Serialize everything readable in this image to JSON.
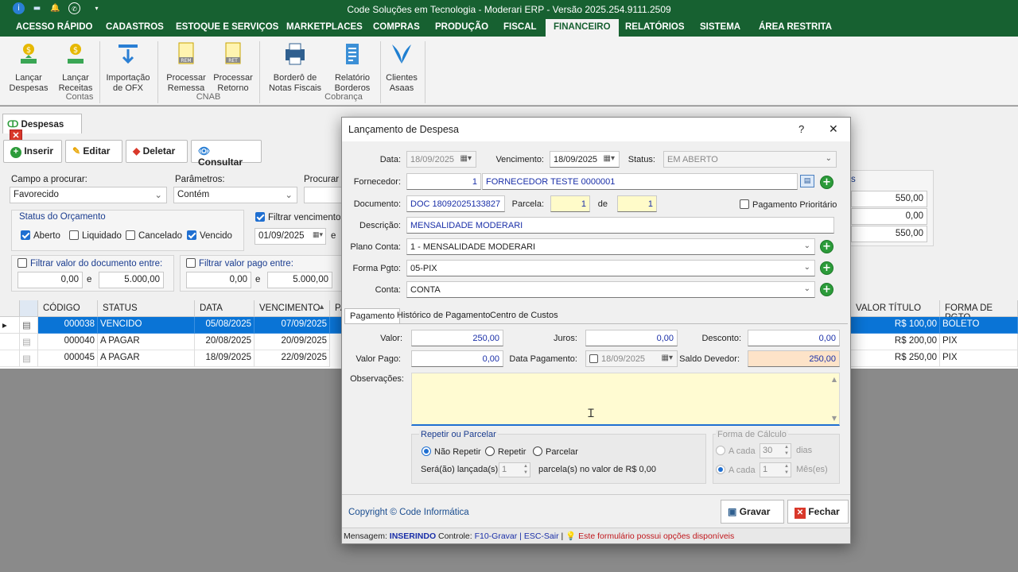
{
  "titlebar": {
    "title": "Code Soluções em Tecnologia - Moderari ERP - Versão 2025.254.9111.2509"
  },
  "menu": [
    "ACESSO RÁPIDO",
    "CADASTROS",
    "ESTOQUE E SERVIÇOS",
    "MARKETPLACES",
    "COMPRAS",
    "PRODUÇÃO",
    "FISCAL",
    "FINANCEIRO",
    "RELATÓRIOS",
    "SISTEMA",
    "ÁREA RESTRITA"
  ],
  "ribbon": {
    "buttons": [
      {
        "l1": "Lançar",
        "l2": "Despesas",
        "icon": "money-out-icon"
      },
      {
        "l1": "Lançar",
        "l2": "Receitas",
        "icon": "money-in-icon"
      },
      {
        "l1": "Importação",
        "l2": "de OFX",
        "icon": "import-icon"
      },
      {
        "l1": "Processar",
        "l2": "Remessa",
        "icon": "rem-file-icon"
      },
      {
        "l1": "Processar",
        "l2": "Retorno",
        "icon": "ret-file-icon"
      },
      {
        "l1": "Borderô de",
        "l2": "Notas Fiscais",
        "icon": "printer-icon"
      },
      {
        "l1": "Relatório",
        "l2": "Borderos",
        "icon": "report-icon"
      },
      {
        "l1": "Clientes",
        "l2": "Asaas",
        "icon": "asaas-icon"
      }
    ],
    "groups": [
      "Contas",
      "CNAB",
      "Cobrança"
    ]
  },
  "tab": {
    "label": "Despesas"
  },
  "toolbar": {
    "insert": "Inserir",
    "edit": "Editar",
    "delete": "Deletar",
    "query": "Consultar"
  },
  "filters": {
    "field_label": "Campo a procurar:",
    "field_value": "Favorecido",
    "params_label": "Parâmetros:",
    "params_value": "Contém",
    "search_label": "Procurar p",
    "status_group": "Status do Orçamento",
    "status_opts": [
      {
        "label": "Aberto",
        "on": true
      },
      {
        "label": "Liquidado",
        "on": false
      },
      {
        "label": "Cancelado",
        "on": false
      },
      {
        "label": "Vencido",
        "on": true
      }
    ],
    "venc_label": "Filtrar vencimentos e",
    "venc_from": "01/09/2025",
    "venc_e": "e",
    "valor_doc_label": "Filtrar valor do documento entre:",
    "valor_doc_from": "0,00",
    "valor_doc_e": "e",
    "valor_doc_to": "5.000,00",
    "valor_pago_label": "Filtrar valor pago entre:",
    "valor_pago_from": "0,00",
    "valor_pago_e": "e",
    "valor_pago_to": "5.000,00",
    "totals_cut": "s",
    "totals": [
      "550,00",
      "0,00",
      "550,00"
    ]
  },
  "grid": {
    "headers": {
      "codigo": "CÓDIGO",
      "status": "STATUS",
      "data": "DATA",
      "venc": "VENCIMENTO",
      "cut": "PA",
      "valor": "VALOR TÍTULO",
      "forma": "FORMA DE PGTO"
    },
    "rows": [
      {
        "codigo": "000038",
        "status": "VENCIDO",
        "data": "05/08/2025",
        "venc": "07/09/2025",
        "valor": "R$ 100,00",
        "forma": "BOLETO"
      },
      {
        "codigo": "000040",
        "status": "A PAGAR",
        "data": "20/08/2025",
        "venc": "20/09/2025",
        "valor": "R$ 200,00",
        "forma": "PIX"
      },
      {
        "codigo": "000045",
        "status": "A PAGAR",
        "data": "18/09/2025",
        "venc": "22/09/2025",
        "valor": "R$ 250,00",
        "forma": "PIX"
      }
    ]
  },
  "dialog": {
    "title": "Lançamento de Despesa",
    "help": "?",
    "close": "✕",
    "data_label": "Data:",
    "data_value": "18/09/2025",
    "venc_label": "Vencimento:",
    "venc_value": "18/09/2025",
    "status_label": "Status:",
    "status_value": "EM ABERTO",
    "fornecedor_label": "Fornecedor:",
    "fornecedor_code": "1",
    "fornecedor_name": "FORNECEDOR TESTE 0000001",
    "documento_label": "Documento:",
    "documento_value": "DOC 18092025133827",
    "parcela_label": "Parcela:",
    "parcela_value": "1",
    "de_label": "de",
    "de_value": "1",
    "prioritario_label": "Pagamento Prioritário",
    "descricao_label": "Descrição:",
    "descricao_value": "MENSALIDADE MODERARI",
    "plano_label": "Plano Conta:",
    "plano_value": "1 - MENSALIDADE MODERARI",
    "forma_label": "Forma Pgto:",
    "forma_value": "05-PIX",
    "conta_label": "Conta:",
    "conta_value": "CONTA",
    "tabs": [
      "Pagamento",
      "Histórico de Pagamento",
      "Centro de Custos"
    ],
    "valor_label": "Valor:",
    "valor_value": "250,00",
    "juros_label": "Juros:",
    "juros_value": "0,00",
    "desconto_label": "Desconto:",
    "desconto_value": "0,00",
    "valor_pago_label": "Valor Pago:",
    "valor_pago_value": "0,00",
    "data_pag_label": "Data Pagamento:",
    "data_pag_value": "18/09/2025",
    "saldo_label": "Saldo Devedor:",
    "saldo_value": "250,00",
    "obs_label": "Observações:",
    "repetir_group": "Repetir ou Parcelar",
    "radio_nao": "Não Repetir",
    "radio_repetir": "Repetir",
    "radio_parcelar": "Parcelar",
    "sera_label": "Será(ão) lançada(s)",
    "sera_value": "1",
    "parcela_valor_text": "parcela(s) no valor de R$ 0,00",
    "calc_group": "Forma de Cálculo",
    "acada1": "A cada",
    "acada1_value": "30",
    "dias": "dias",
    "acada2": "A cada",
    "acada2_value": "1",
    "meses": "Mês(es)",
    "copyright": "Copyright © Code Informática",
    "gravar": "Gravar",
    "fechar": "Fechar",
    "msg_label": "Mensagem:",
    "msg_value": "INSERINDO",
    "ctrl_label": "Controle:",
    "ctrl_value": "F10-Gravar | ESC-Sair",
    "pipe": "|",
    "hint": "Este formulário possui opções disponíveis"
  }
}
